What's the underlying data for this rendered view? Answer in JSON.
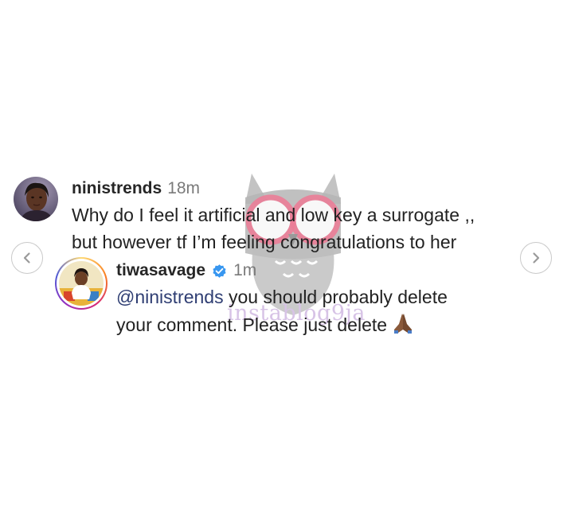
{
  "comments": [
    {
      "username": "ninistrends",
      "time": "18m",
      "lines": [
        "Why do I feel it artificial and low key a surrogate ,,",
        "but however tf I’m feeling congratulations to her"
      ]
    },
    {
      "username": "tiwasavage",
      "verified": true,
      "time": "1m",
      "mention": "@ninistrends",
      "line1_rest": " you should probably delete",
      "line2": "your comment. Please just delete",
      "emoji": "folded-hands-emoji"
    }
  ],
  "watermark": {
    "text": "instablog9ja"
  },
  "icons": {
    "prev": "chevron-left-icon",
    "next": "chevron-right-icon",
    "verified": "verified-badge-icon"
  },
  "colors": {
    "verified": "#3897f0",
    "mention": "#2f3e73",
    "time": "#7a7a7a"
  }
}
